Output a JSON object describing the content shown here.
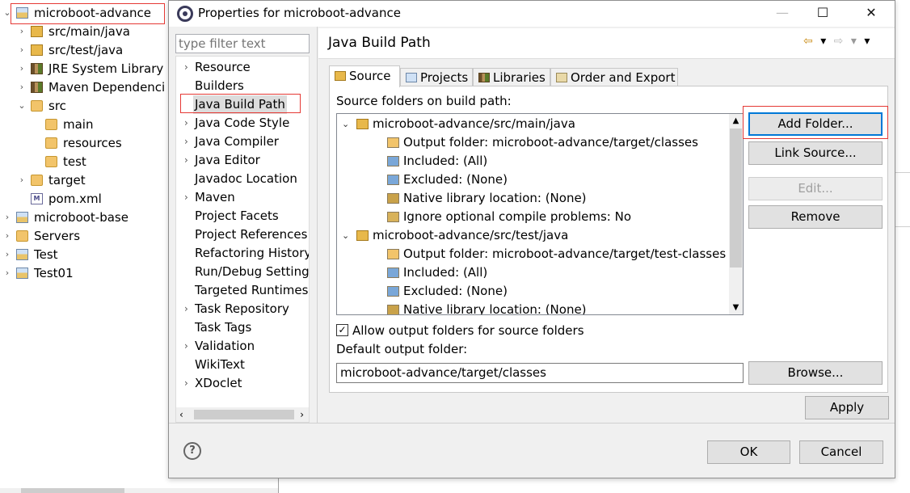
{
  "explorer": {
    "items": [
      {
        "label": "microboot-advance",
        "expand": "⌄",
        "icon": "java-project-icon"
      },
      {
        "label": "src/main/java",
        "expand": "›",
        "icon": "source-folder-icon"
      },
      {
        "label": "src/test/java",
        "expand": "›",
        "icon": "source-folder-icon"
      },
      {
        "label": "JRE System Library [",
        "expand": "›",
        "icon": "library-icon"
      },
      {
        "label": "Maven Dependenci",
        "expand": "›",
        "icon": "library-icon"
      },
      {
        "label": "src",
        "expand": "⌄",
        "icon": "folder-icon"
      },
      {
        "label": "main",
        "expand": "",
        "icon": "folder-icon"
      },
      {
        "label": "resources",
        "expand": "",
        "icon": "folder-icon"
      },
      {
        "label": "test",
        "expand": "",
        "icon": "folder-icon"
      },
      {
        "label": "target",
        "expand": "›",
        "icon": "folder-icon"
      },
      {
        "label": "pom.xml",
        "expand": "",
        "icon": "xml-file-icon"
      },
      {
        "label": "microboot-base",
        "expand": "›",
        "icon": "java-project-icon"
      },
      {
        "label": "Servers",
        "expand": "›",
        "icon": "folder-icon"
      },
      {
        "label": "Test",
        "expand": "›",
        "icon": "java-project-icon"
      },
      {
        "label": "Test01",
        "expand": "›",
        "icon": "java-project-icon"
      }
    ]
  },
  "dialog": {
    "title": "Properties for microboot-advance",
    "window_buttons": {
      "minimize": "—",
      "maximize": "☐",
      "close": "✕"
    },
    "filter_placeholder": "type filter text",
    "nav": [
      {
        "label": "Resource",
        "expand": "›"
      },
      {
        "label": "Builders",
        "expand": ""
      },
      {
        "label": "Java Build Path",
        "expand": ""
      },
      {
        "label": "Java Code Style",
        "expand": "›"
      },
      {
        "label": "Java Compiler",
        "expand": "›"
      },
      {
        "label": "Java Editor",
        "expand": "›"
      },
      {
        "label": "Javadoc Location",
        "expand": ""
      },
      {
        "label": "Maven",
        "expand": "›"
      },
      {
        "label": "Project Facets",
        "expand": ""
      },
      {
        "label": "Project References",
        "expand": ""
      },
      {
        "label": "Refactoring History",
        "expand": ""
      },
      {
        "label": "Run/Debug Settings",
        "expand": ""
      },
      {
        "label": "Targeted Runtimes",
        "expand": ""
      },
      {
        "label": "Task Repository",
        "expand": "›"
      },
      {
        "label": "Task Tags",
        "expand": ""
      },
      {
        "label": "Validation",
        "expand": "›"
      },
      {
        "label": "WikiText",
        "expand": ""
      },
      {
        "label": "XDoclet",
        "expand": "›"
      }
    ],
    "nav_scroll": {
      "left": "‹",
      "right": "›"
    },
    "page_title": "Java Build Path",
    "history_nav": {
      "back": "⇦",
      "back_menu": "▾",
      "forward": "⇨",
      "forward_menu": "▾",
      "view_menu": "▾"
    },
    "tabs": [
      "Source",
      "Projects",
      "Libraries",
      "Order and Export"
    ],
    "source_label": "Source folders on build path:",
    "source_tree": [
      {
        "label": "microboot-advance/src/main/java",
        "level": 0,
        "expand": "⌄"
      },
      {
        "label": "Output folder: microboot-advance/target/classes",
        "level": 1,
        "expand": ""
      },
      {
        "label": "Included: (All)",
        "level": 1,
        "expand": ""
      },
      {
        "label": "Excluded: (None)",
        "level": 1,
        "expand": ""
      },
      {
        "label": "Native library location: (None)",
        "level": 1,
        "expand": ""
      },
      {
        "label": "Ignore optional compile problems: No",
        "level": 1,
        "expand": ""
      },
      {
        "label": "microboot-advance/src/test/java",
        "level": 0,
        "expand": "⌄"
      },
      {
        "label": "Output folder: microboot-advance/target/test-classes",
        "level": 1,
        "expand": ""
      },
      {
        "label": "Included: (All)",
        "level": 1,
        "expand": ""
      },
      {
        "label": "Excluded: (None)",
        "level": 1,
        "expand": ""
      },
      {
        "label": "Native library location: (None)",
        "level": 1,
        "expand": ""
      }
    ],
    "scroll_arrows": {
      "up": "▲",
      "down": "▼"
    },
    "buttons": {
      "add_folder": "Add Folder...",
      "link_source": "Link Source...",
      "edit": "Edit...",
      "remove": "Remove",
      "browse": "Browse...",
      "apply": "Apply",
      "ok": "OK",
      "cancel": "Cancel"
    },
    "allow_output_label": "Allow output folders for source folders",
    "allow_output_checked": "✓",
    "default_output_label": "Default output folder:",
    "default_output_value": "microboot-advance/target/classes",
    "help": "?"
  },
  "colors": {
    "highlight_box": "#e53935",
    "primary_button_border": "#0078d7"
  }
}
